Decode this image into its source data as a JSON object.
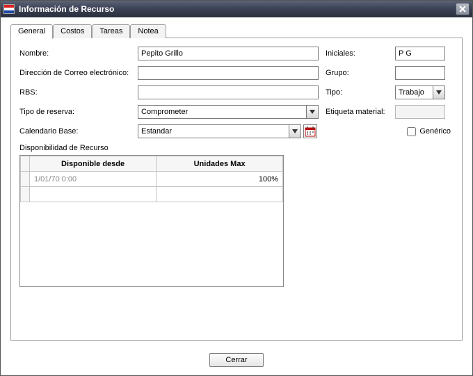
{
  "window": {
    "title": "Información de Recurso"
  },
  "tabs": {
    "general": "General",
    "costos": "Costos",
    "tareas": "Tareas",
    "notea": "Notea"
  },
  "labels": {
    "nombre": "Nombre:",
    "iniciales": "Iniciales:",
    "direccion": "Dirección de Correo electrónico:",
    "grupo": "Grupo:",
    "rbs": "RBS:",
    "tipo": "Tipo:",
    "tipo_reserva": "Tipo de reserva:",
    "etiqueta_material": "Etiqueta material:",
    "calendario_base": "Calendario Base:",
    "generico": "Genérico",
    "disponibilidad": "Disponibilidad de Recurso"
  },
  "values": {
    "nombre": "Pepito Grillo",
    "iniciales": "P G",
    "direccion": "",
    "grupo": "",
    "rbs": "",
    "tipo": "Trabajo",
    "tipo_reserva": "Comprometer",
    "calendario_base": "Estandar",
    "generico_checked": false
  },
  "grid": {
    "headers": {
      "disponible_desde": "Disponible desde",
      "unidades_max": "Unidades Max"
    },
    "rows": [
      {
        "fecha": "1/01/70 0:00",
        "unidades": "100%"
      },
      {
        "fecha": "",
        "unidades": ""
      }
    ]
  },
  "buttons": {
    "cerrar": "Cerrar"
  }
}
